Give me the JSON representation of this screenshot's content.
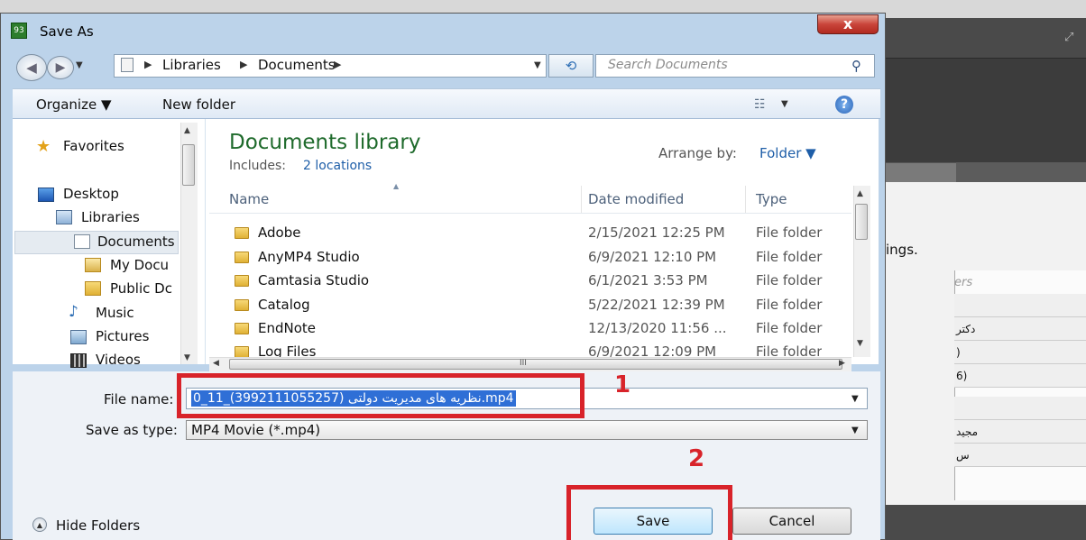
{
  "dialog": {
    "title": "Save As",
    "close_label": "x",
    "app_icon": "93"
  },
  "nav": {
    "back_glyph": "◀",
    "forward_glyph": "▶",
    "breadcrumb": [
      "Libraries",
      "Documents"
    ],
    "separator": "▶",
    "dropdown": "▼",
    "refresh": "⟲",
    "search_placeholder": "Search Documents",
    "search_glyph": "⚲"
  },
  "toolbar": {
    "organize": "Organize ▼",
    "new_folder": "New folder",
    "view_glyph": "☷",
    "view_drop": "▼",
    "help": "?"
  },
  "navpane": {
    "items": [
      {
        "label": "Favorites",
        "icon": "star-icon"
      },
      {
        "label": "Desktop",
        "icon": "desktop-icon"
      },
      {
        "label": "Libraries",
        "icon": "libraries-icon"
      },
      {
        "label": "Documents",
        "icon": "documents-icon"
      },
      {
        "label": "My Docu",
        "icon": "document-folder-icon"
      },
      {
        "label": "Public Dc",
        "icon": "folder-icon"
      },
      {
        "label": "Music",
        "icon": "music-icon"
      },
      {
        "label": "Pictures",
        "icon": "pictures-icon"
      },
      {
        "label": "Videos",
        "icon": "videos-icon"
      }
    ]
  },
  "library": {
    "title": "Documents library",
    "includes_label": "Includes:",
    "locations": "2 locations",
    "arrange_label": "Arrange by:",
    "arrange_value": "Folder ▼"
  },
  "columns": {
    "name": "Name",
    "date": "Date modified",
    "type": "Type"
  },
  "files": [
    {
      "name": "Adobe",
      "date": "2/15/2021 12:25 PM",
      "type": "File folder"
    },
    {
      "name": "AnyMP4 Studio",
      "date": "6/9/2021 12:10 PM",
      "type": "File folder"
    },
    {
      "name": "Camtasia Studio",
      "date": "6/1/2021 3:53 PM",
      "type": "File folder"
    },
    {
      "name": "Catalog",
      "date": "5/22/2021 12:39 PM",
      "type": "File folder"
    },
    {
      "name": "EndNote",
      "date": "12/13/2020 11:56 ...",
      "type": "File folder"
    },
    {
      "name": "Log Files",
      "date": "6/9/2021 12:09 PM",
      "type": "File folder"
    }
  ],
  "form": {
    "file_name_label": "File name:",
    "file_name_value": "0_11_(3992111055257) نظریه های مدیریت دولتی.mp4",
    "save_type_label": "Save as type:",
    "save_type_value": "MP4 Movie (*.mp4)"
  },
  "bottom": {
    "hide_folders": "Hide Folders",
    "save": "Save",
    "cancel": "Cancel"
  },
  "annotations": {
    "step1": "1",
    "step2": "2",
    "color": "#d8232a"
  },
  "background_app": {
    "text_fragment": "ings.",
    "placeholder": "ers",
    "rows": [
      "",
      "دکتر",
      ")",
      "6)",
      "",
      "مجید",
      "س"
    ]
  },
  "scroll_grip": "III"
}
